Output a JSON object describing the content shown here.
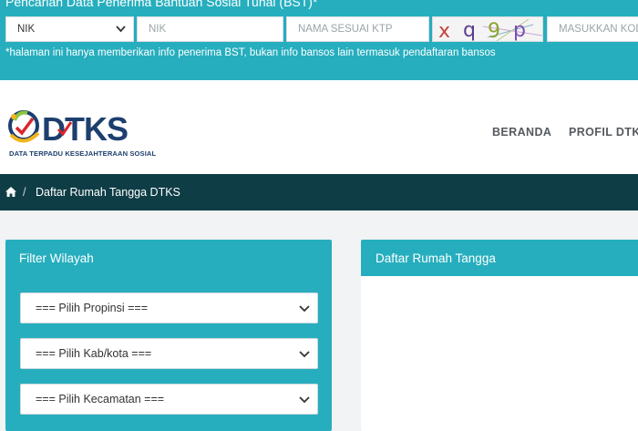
{
  "search": {
    "title": "Pencarian Data Penerima Bantuan Sosial Tunai (BST)*",
    "id_type_selected": "NIK",
    "nik_placeholder": "NIK",
    "name_placeholder": "NAMA SESUAI KTP",
    "captcha_text": "xq9p",
    "captcha_placeholder": "MASUKKAN KODE",
    "note": "*halaman ini hanya memberikan info penerima BST, bukan info bansos lain termasuk pendaftaran bansos"
  },
  "header": {
    "logo_text": "DTKS",
    "logo_tagline": "DATA TERPADU KESEJAHTERAAN SOSIAL",
    "nav": [
      "BERANDA",
      "PROFIL DTKS"
    ]
  },
  "breadcrumb": {
    "current": "Daftar Rumah Tangga DTKS"
  },
  "filter_panel": {
    "title": "Filter Wilayah",
    "selects": [
      "=== Pilih Propinsi ===",
      "=== Pilih Kab/kota ===",
      "=== Pilih Kecamatan ==="
    ]
  },
  "list_panel": {
    "title": "Daftar Rumah Tangga"
  },
  "colors": {
    "teal": "#26aebe",
    "dark_teal": "#0f3d46",
    "logo_blue": "#1d3f6e"
  }
}
